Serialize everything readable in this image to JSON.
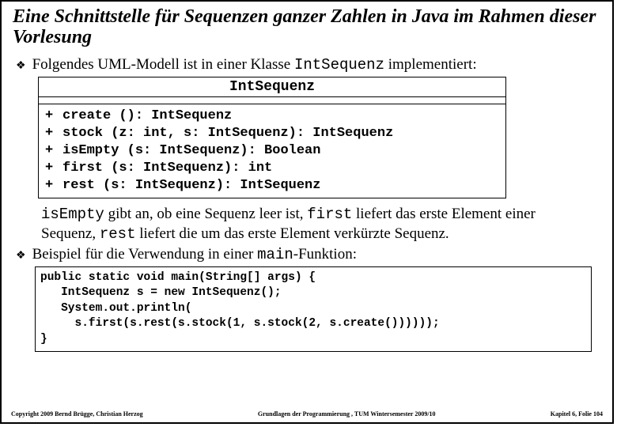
{
  "title": "Eine Schnittstelle für Sequenzen ganzer Zahlen in Java im Rahmen dieser Vorlesung",
  "intro": {
    "pre": "Folgendes UML-Modell ist in einer Klasse ",
    "code": "IntSequenz",
    "post": " implementiert:"
  },
  "uml": {
    "class_name": "IntSequenz",
    "operations": [
      {
        "vis": "+",
        "sig": "create (): IntSequenz"
      },
      {
        "vis": "+",
        "sig": "stock (z: int, s: IntSequenz): IntSequenz"
      },
      {
        "vis": "+",
        "sig": "isEmpty (s: IntSequenz): Boolean"
      },
      {
        "vis": "+",
        "sig": "first (s: IntSequenz): int"
      },
      {
        "vis": "+",
        "sig": "rest (s: IntSequenz): IntSequenz"
      }
    ]
  },
  "desc": {
    "p1_a": "isEmpty",
    "p1_b": " gibt an, ob eine Sequenz leer ist, ",
    "p1_c": "first",
    "p1_d": " liefert das erste Element einer Sequenz, ",
    "p1_e": "rest",
    "p1_f": " liefert die um das erste Element verkürzte Sequenz."
  },
  "example": {
    "pre": "Beispiel für die Verwendung in einer ",
    "code": "main",
    "post": "-Funktion:"
  },
  "code_lines": {
    "l1": "public static void main(String[] args) {",
    "l2": "   IntSequenz s = new IntSequenz();",
    "l3": "   System.out.println(",
    "l4": "     s.first(s.rest(s.stock(1, s.stock(2, s.create())))));",
    "l5": "}"
  },
  "footer": {
    "left": "Copyright 2009 Bernd Brügge, Christian Herzog",
    "center": "Grundlagen der Programmierung ,   TUM Wintersemester 2009/10",
    "right": "Kapitel 6, Folie 104"
  }
}
